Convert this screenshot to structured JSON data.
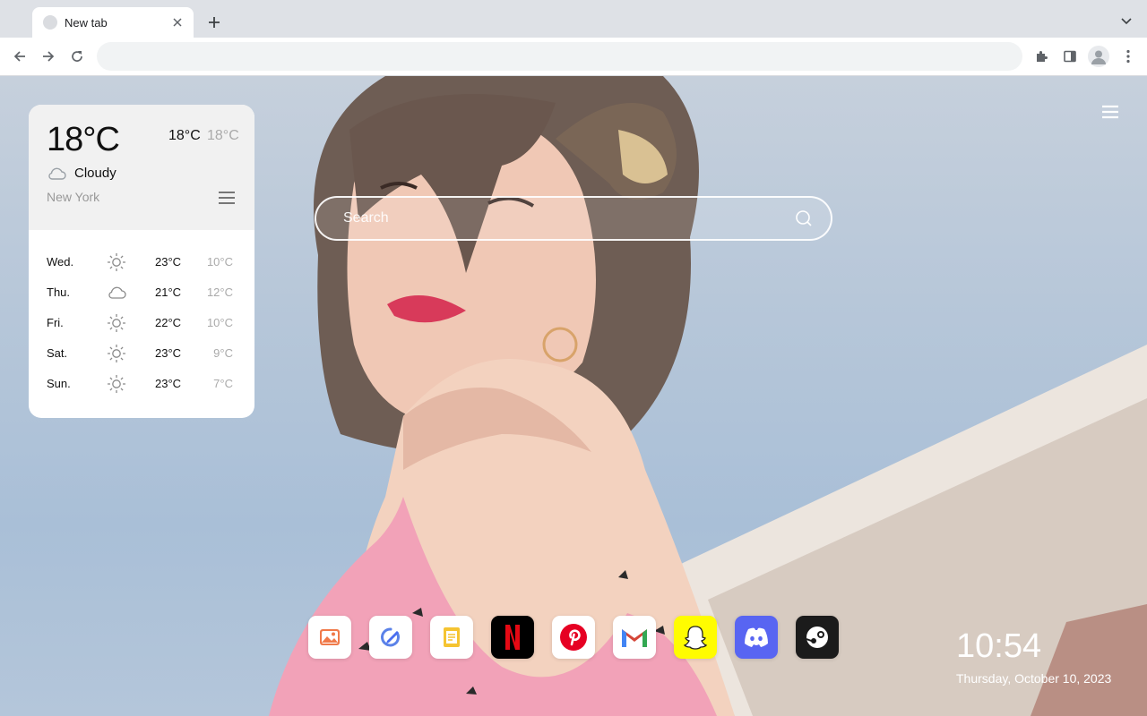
{
  "browser": {
    "tab_title": "New tab",
    "address_value": "",
    "address_placeholder": ""
  },
  "weather": {
    "current_temp": "18°C",
    "high": "18°C",
    "low": "18°C",
    "condition": "Cloudy",
    "city": "New York",
    "forecast": [
      {
        "day": "Wed.",
        "icon": "sun-icon",
        "high": "23°C",
        "low": "10°C"
      },
      {
        "day": "Thu.",
        "icon": "cloud-icon",
        "high": "21°C",
        "low": "12°C"
      },
      {
        "day": "Fri.",
        "icon": "sun-icon",
        "high": "22°C",
        "low": "10°C"
      },
      {
        "day": "Sat.",
        "icon": "sun-icon",
        "high": "23°C",
        "low": "9°C"
      },
      {
        "day": "Sun.",
        "icon": "sun-icon",
        "high": "23°C",
        "low": "7°C"
      }
    ]
  },
  "search": {
    "placeholder": "Search"
  },
  "dock": {
    "apps": [
      {
        "name": "gallery",
        "icon": "image-icon",
        "bg": "#ffffff"
      },
      {
        "name": "pen",
        "icon": "pen-icon",
        "bg": "#ffffff"
      },
      {
        "name": "notes",
        "icon": "notes-icon",
        "bg": "#ffffff"
      },
      {
        "name": "Netflix",
        "icon": "netflix-icon",
        "bg": "#000000"
      },
      {
        "name": "Pinterest",
        "icon": "pinterest-icon",
        "bg": "#ffffff"
      },
      {
        "name": "Gmail",
        "icon": "gmail-icon",
        "bg": "#ffffff"
      },
      {
        "name": "Snapchat",
        "icon": "snapchat-icon",
        "bg": "#fffc00"
      },
      {
        "name": "Discord",
        "icon": "discord-icon",
        "bg": "#5865f2"
      },
      {
        "name": "Steam",
        "icon": "steam-icon",
        "bg": "#1b1b1b"
      }
    ]
  },
  "clock": {
    "time": "10:54",
    "date": "Thursday, October 10, 2023"
  },
  "colors": {
    "chrome_bg": "#dee1e6",
    "toolbar_bg": "#ffffff",
    "omnibox_bg": "#f1f3f4"
  }
}
